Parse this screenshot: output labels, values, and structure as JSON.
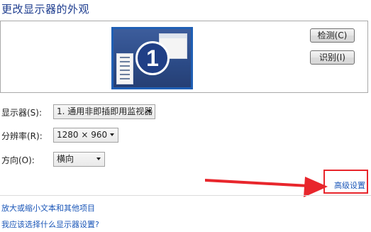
{
  "title": "更改显示器的外观",
  "monitor": {
    "number": "1"
  },
  "buttons": {
    "detect": "检测(C)",
    "identify": "识别(I)"
  },
  "settings": {
    "display_label": "显示器(S):",
    "display_value": "1. 通用非即插即用监视器",
    "resolution_label": "分辨率(R):",
    "resolution_value": "1280 × 960",
    "orientation_label": "方向(O):",
    "orientation_value": "横向"
  },
  "advanced_link": "高级设置",
  "links": {
    "text_size": "放大或缩小文本和其他项目",
    "which_setting": "我应该选择什么显示器设置?"
  },
  "annotation": {
    "color": "#e8262c"
  }
}
